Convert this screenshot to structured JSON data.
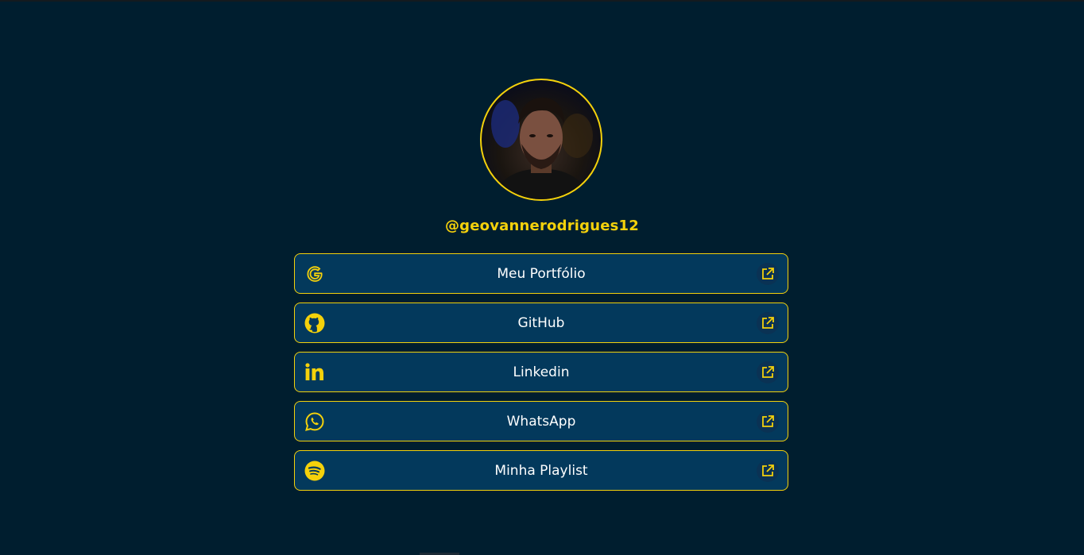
{
  "profile": {
    "handle": "@geovannerodrigues12"
  },
  "links": [
    {
      "label": "Meu Portfólio",
      "icon": "google-icon"
    },
    {
      "label": "GitHub",
      "icon": "github-icon"
    },
    {
      "label": "Linkedin",
      "icon": "linkedin-icon"
    },
    {
      "label": "WhatsApp",
      "icon": "whatsapp-icon"
    },
    {
      "label": "Minha Playlist",
      "icon": "spotify-icon"
    }
  ],
  "colors": {
    "background": "#001e2f",
    "card": "#03395c",
    "accent": "#f4d10b",
    "text": "#ffffff"
  }
}
